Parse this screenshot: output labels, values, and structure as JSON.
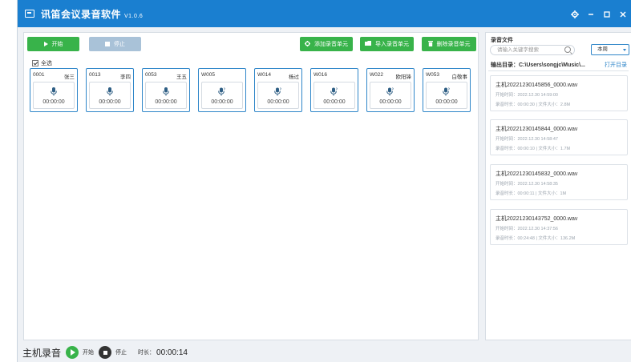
{
  "app": {
    "title": "讯笛会议录音软件",
    "version": "V1.0.6"
  },
  "window_controls": {
    "settings": "gear-icon",
    "minimize": "minimize-icon",
    "maximize": "maximize-icon",
    "close": "close-icon"
  },
  "toolbar": {
    "start_label": "开始",
    "stop_label": "停止",
    "add_label": "添加录音单元",
    "import_label": "导入录音单元",
    "delete_label": "删除录音单元",
    "select_all_label": "全选"
  },
  "cards": [
    {
      "id": "0001",
      "name": "张三",
      "time": "00:00:00"
    },
    {
      "id": "0013",
      "name": "李四",
      "time": "00:00:00"
    },
    {
      "id": "0053",
      "name": "王五",
      "time": "00:00:00"
    },
    {
      "id": "W005",
      "name": "",
      "time": "00:00:00"
    },
    {
      "id": "W014",
      "name": "杨过",
      "time": "00:00:00"
    },
    {
      "id": "W016",
      "name": "",
      "time": "00:00:00"
    },
    {
      "id": "W022",
      "name": "欧阳锋",
      "time": "00:00:00"
    },
    {
      "id": "W053",
      "name": "白敬事",
      "time": "00:00:00"
    }
  ],
  "files_panel": {
    "title": "录音文件",
    "search_placeholder": "请输入关键字搜索",
    "period": "本周",
    "output_dir": "输出目录：C:\\Users\\songjc\\Music\\...",
    "open_dir": "打开目录",
    "files": [
      {
        "name": "主机20221230145856_0000.wav",
        "start": "开始时间：2022.12.30 14:59:00",
        "meta": "录音时长：00:00:30   |   文件大小：2.8M"
      },
      {
        "name": "主机20221230145844_0000.wav",
        "start": "开始时间：2022.12.30 14:58:47",
        "meta": "录音时长：00:00:10   |   文件大小：1.7M"
      },
      {
        "name": "主机20221230145832_0000.wav",
        "start": "开始时间：2022.12.30 14:58:35",
        "meta": "录音时长：00:00:11   |   文件大小：1M"
      },
      {
        "name": "主机20221230143752_0000.wav",
        "start": "开始时间：2022.12.30 14:37:56",
        "meta": "录音时长：00:24:48   |   文件大小：136.2M"
      }
    ]
  },
  "footer": {
    "title": "主机录音",
    "start_label": "开始",
    "stop_label": "停止",
    "duration_label": "时长：",
    "duration_value": "00:00:14"
  },
  "colors": {
    "titlebar": "#1a7fd0",
    "accent_green": "#38b34a",
    "card_border": "#2f86c9",
    "disabled": "#a9c2d8"
  }
}
